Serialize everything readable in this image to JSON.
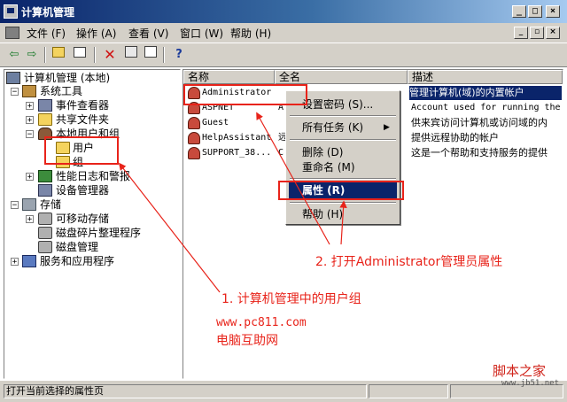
{
  "window": {
    "title": "计算机管理"
  },
  "menu": [
    "文件 (F)",
    "操作 (A)",
    "查看 (V)",
    "窗口 (W)",
    "帮助 (H)"
  ],
  "icons": {
    "toolbar": [
      "back-icon",
      "forward-icon",
      "up-folder-icon",
      "show-tree-icon",
      "delete-icon",
      "properties-icon",
      "export-icon",
      "help-icon"
    ]
  },
  "tree": {
    "root": "计算机管理 (本地)",
    "system_tools": "系统工具",
    "event_viewer": "事件查看器",
    "shared_folders": "共享文件夹",
    "local_users_groups": "本地用户和组",
    "users": "用户",
    "groups": "组",
    "perf_logs": "性能日志和警报",
    "device_manager": "设备管理器",
    "storage": "存储",
    "removable_storage": "可移动存储",
    "defrag": "磁盘碎片整理程序",
    "disk_mgmt": "磁盘管理",
    "services_apps": "服务和应用程序"
  },
  "list": {
    "columns": [
      "名称",
      "全名",
      "描述"
    ],
    "rows": [
      {
        "name": "Administrator",
        "fullname": "",
        "desc": "管理计算机(域)的内置帐户"
      },
      {
        "name": "ASPNET",
        "fullname": "A",
        "desc": "Account used for running the"
      },
      {
        "name": "Guest",
        "fullname": "",
        "desc": "供来宾访问计算机或访问域的内"
      },
      {
        "name": "HelpAssistant",
        "fullname": "远",
        "desc": "提供远程协助的帐户"
      },
      {
        "name": "SUPPORT_38...",
        "fullname": "C",
        "desc": "这是一个帮助和支持服务的提供"
      }
    ]
  },
  "context_menu": {
    "set_password": "设置密码 (S)...",
    "all_tasks": "所有任务 (K)",
    "arrow": "▶",
    "delete": "删除 (D)",
    "rename": "重命名 (M)",
    "properties": "属性 (R)",
    "help": "帮助 (H)"
  },
  "status": {
    "text": "打开当前选择的属性页"
  },
  "annotations": {
    "step1": "1. 计算机管理中的用户组",
    "step2": "2. 打开Administrator管理员属性",
    "site_url": "www.pc811.com",
    "site_name": "电脑互助网",
    "watermark": "脚本之家",
    "watermark_url": "www.jb51.net"
  },
  "colors": {
    "annotation_red": "#e8231a",
    "selection_blue": "#0a246a",
    "chrome": "#d4d0c8"
  }
}
